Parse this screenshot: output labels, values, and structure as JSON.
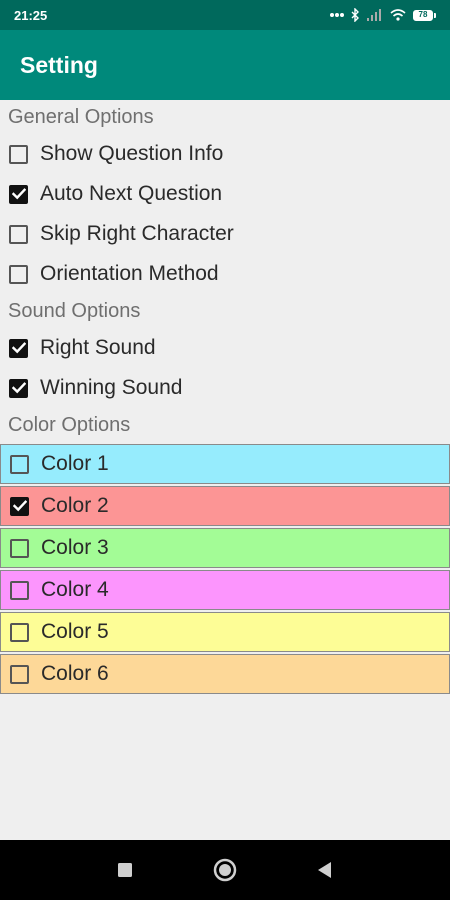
{
  "status_bar": {
    "time": "21:25",
    "battery_level": "78"
  },
  "app_bar": {
    "title": "Setting"
  },
  "general": {
    "header": "General Options",
    "options": [
      {
        "label": "Show Question Info",
        "checked": false
      },
      {
        "label": "Auto Next Question",
        "checked": true
      },
      {
        "label": "Skip Right Character",
        "checked": false
      },
      {
        "label": "Orientation Method",
        "checked": false
      }
    ]
  },
  "sound": {
    "header": "Sound Options",
    "options": [
      {
        "label": "Right Sound",
        "checked": true
      },
      {
        "label": "Winning Sound",
        "checked": true
      }
    ]
  },
  "color": {
    "header": "Color Options",
    "options": [
      {
        "label": "Color 1",
        "checked": false,
        "bg": "#96ecfd"
      },
      {
        "label": "Color 2",
        "checked": true,
        "bg": "#fc9595"
      },
      {
        "label": "Color 3",
        "checked": false,
        "bg": "#a3fc96"
      },
      {
        "label": "Color 4",
        "checked": false,
        "bg": "#fc95fd"
      },
      {
        "label": "Color 5",
        "checked": false,
        "bg": "#fdfd96"
      },
      {
        "label": "Color 6",
        "checked": false,
        "bg": "#fdd898"
      }
    ]
  },
  "nav": {
    "icons": [
      "recents-square-icon",
      "home-circle-icon",
      "back-triangle-icon"
    ]
  },
  "colors": {
    "status_bar": "#00695c",
    "app_bar": "#00897b",
    "background": "#efefef"
  }
}
